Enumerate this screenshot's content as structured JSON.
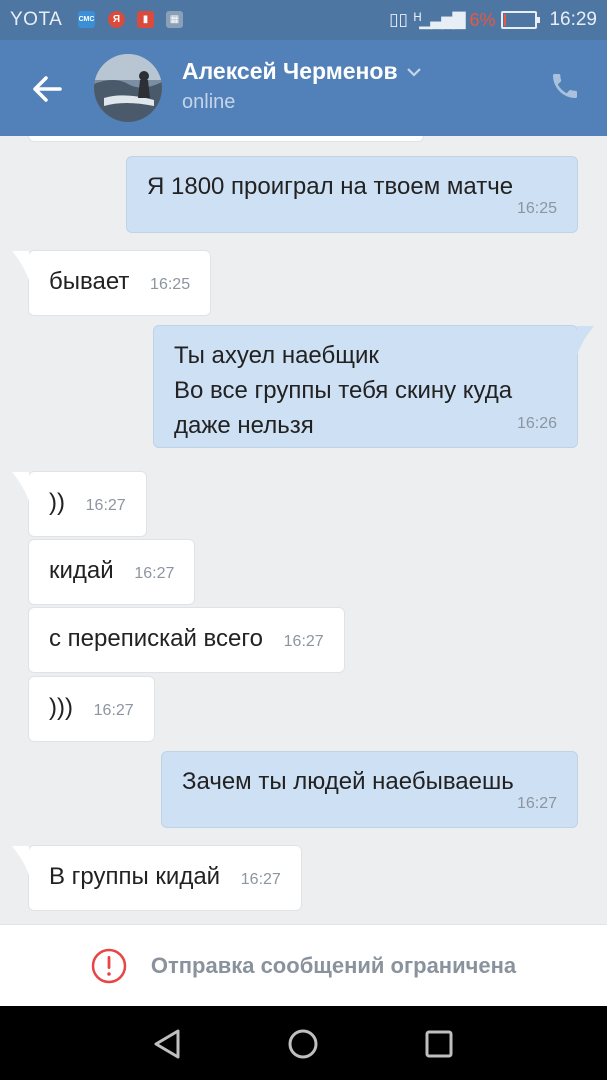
{
  "status_bar": {
    "carrier": "YOTA",
    "battery": "6%",
    "time": "16:29"
  },
  "header": {
    "contact_name": "Алексей Черменов",
    "contact_status": "online"
  },
  "messages": [
    {
      "direction": "out",
      "text": "Я 1800 проиграл на твоем матче",
      "time": "16:25"
    },
    {
      "direction": "in",
      "text": "бывает",
      "time": "16:25"
    },
    {
      "direction": "out",
      "lines": [
        "Ты ахуел наебщик",
        "Во все группы тебя скину куда",
        "даже нельзя"
      ],
      "time": "16:26"
    },
    {
      "direction": "in",
      "text": "))",
      "time": "16:27"
    },
    {
      "direction": "in",
      "text": "кидай",
      "time": "16:27"
    },
    {
      "direction": "in",
      "text": "с перепискай всего",
      "time": "16:27"
    },
    {
      "direction": "in",
      "text": ")))",
      "time": "16:27"
    },
    {
      "direction": "out",
      "text": "Зачем ты людей наебываешь",
      "time": "16:27"
    },
    {
      "direction": "in",
      "text": "В группы кидай",
      "time": "16:27"
    }
  ],
  "footer": {
    "restriction_text": "Отправка сообщений ограничена"
  },
  "icons": {
    "back": "arrow-left-icon",
    "call": "phone-icon",
    "chevron": "chevron-down-icon",
    "restriction": "exclamation-circle-icon",
    "nav_back": "triangle-back-icon",
    "nav_home": "circle-home-icon",
    "nav_recents": "square-recents-icon"
  },
  "colors": {
    "header_bg": "#5181b8",
    "status_bar_bg": "#4e76a3",
    "outgoing_bubble": "#cee0f4",
    "incoming_bubble": "#ffffff",
    "chat_bg": "#edeef0",
    "warning_red": "#e64646"
  }
}
